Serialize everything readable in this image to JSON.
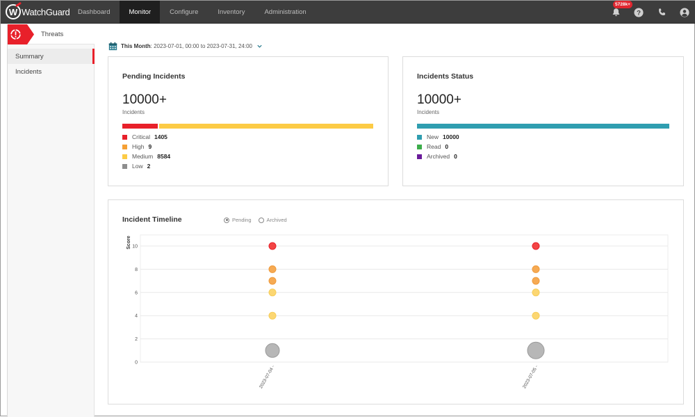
{
  "topnav": {
    "brand": "WatchGuard",
    "tabs": [
      {
        "label": "Dashboard",
        "active": false
      },
      {
        "label": "Monitor",
        "active": true
      },
      {
        "label": "Configure",
        "active": false
      },
      {
        "label": "Inventory",
        "active": false
      },
      {
        "label": "Administration",
        "active": false
      }
    ],
    "notification_badge": "5728k+",
    "icons": [
      "bell-icon",
      "help-icon",
      "phone-icon",
      "user-icon"
    ]
  },
  "sidebar": {
    "section": "Threats",
    "items": [
      {
        "label": "Summary",
        "active": true
      },
      {
        "label": "Incidents",
        "active": false
      }
    ]
  },
  "daterange": {
    "label": "This Month",
    "range": "2023-07-01, 00:00 to 2023-07-31, 24:00"
  },
  "pending": {
    "title": "Pending Incidents",
    "total": "10000+",
    "unit": "Incidents",
    "items": [
      {
        "label": "Critical",
        "value": 1405,
        "color": "#e8202a"
      },
      {
        "label": "High",
        "value": 9,
        "color": "#f5a034"
      },
      {
        "label": "Medium",
        "value": 8584,
        "color": "#fccb45"
      },
      {
        "label": "Low",
        "value": 2,
        "color": "#8e8e8e"
      }
    ]
  },
  "status": {
    "title": "Incidents Status",
    "total": "10000+",
    "unit": "Incidents",
    "items": [
      {
        "label": "New",
        "value": 10000,
        "color": "#2f9eb0"
      },
      {
        "label": "Read",
        "value": 0,
        "color": "#3cad4a"
      },
      {
        "label": "Archived",
        "value": 0,
        "color": "#6a1b9a"
      }
    ]
  },
  "timeline": {
    "title": "Incident Timeline",
    "radios": [
      {
        "label": "Pending",
        "selected": true
      },
      {
        "label": "Archived",
        "selected": false
      }
    ]
  },
  "chart_data": {
    "type": "scatter",
    "title": "Incident Timeline",
    "xlabel": "",
    "ylabel": "Score",
    "ylim": [
      0,
      11
    ],
    "yticks": [
      0,
      2,
      4,
      6,
      8,
      10
    ],
    "categories": [
      "2023-07-04",
      "2023-07-05"
    ],
    "grid": true,
    "points": [
      {
        "x": "2023-07-04",
        "y": 10,
        "severity": "critical",
        "color": "#f23b3b",
        "size": 1
      },
      {
        "x": "2023-07-04",
        "y": 8,
        "severity": "high",
        "color": "#f5a54a",
        "size": 1
      },
      {
        "x": "2023-07-04",
        "y": 7,
        "severity": "high",
        "color": "#f5a54a",
        "size": 1
      },
      {
        "x": "2023-07-04",
        "y": 6,
        "severity": "medium",
        "color": "#fcd56a",
        "size": 1
      },
      {
        "x": "2023-07-04",
        "y": 4,
        "severity": "medium",
        "color": "#fcd56a",
        "size": 1
      },
      {
        "x": "2023-07-04",
        "y": 1,
        "severity": "low",
        "color": "#b3b3b3",
        "size": 2
      },
      {
        "x": "2023-07-05",
        "y": 10,
        "severity": "critical",
        "color": "#f23b3b",
        "size": 1
      },
      {
        "x": "2023-07-05",
        "y": 8,
        "severity": "high",
        "color": "#f5a54a",
        "size": 1
      },
      {
        "x": "2023-07-05",
        "y": 7,
        "severity": "high",
        "color": "#f5a54a",
        "size": 1
      },
      {
        "x": "2023-07-05",
        "y": 6,
        "severity": "medium",
        "color": "#fcd56a",
        "size": 1
      },
      {
        "x": "2023-07-05",
        "y": 4,
        "severity": "medium",
        "color": "#fcd56a",
        "size": 1
      },
      {
        "x": "2023-07-05",
        "y": 1,
        "severity": "low",
        "color": "#b3b3b3",
        "size": 2.4
      }
    ]
  }
}
